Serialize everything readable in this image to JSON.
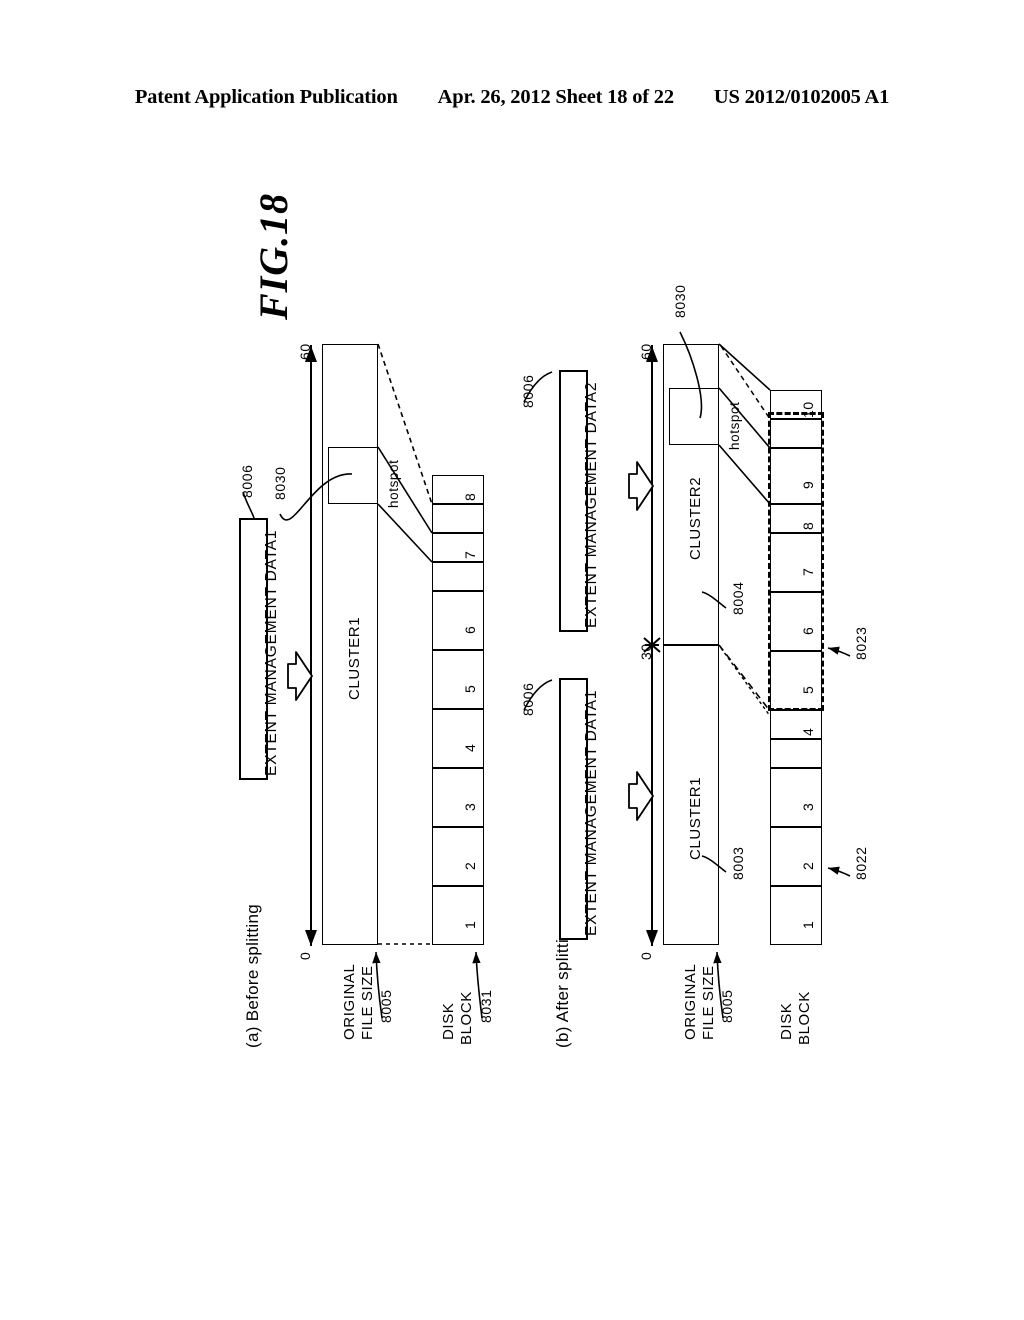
{
  "header": {
    "left": "Patent Application Publication",
    "middle": "Apr. 26, 2012  Sheet 18 of 22",
    "right": "US 2012/0102005 A1"
  },
  "figure": {
    "title": "FIG.18",
    "panels": [
      {
        "id": "a",
        "caption": "(a) Before splitting",
        "extent_box_label": "EXTENT MANAGEMENT DATA1",
        "extent_box_ref": "8006",
        "hotspot_ref": "8030",
        "hotspot_label": "hotspot",
        "clusters": [
          {
            "name": "CLUSTER1",
            "start": 0,
            "end": 60
          }
        ],
        "axis": {
          "ticks": [
            "0",
            "60"
          ],
          "min": 0,
          "max": 60
        },
        "axis_label": "ORIGINAL\nFILE SIZE",
        "axis_label_line1": "ORIGINAL",
        "axis_label_line2": "FILE SIZE",
        "axis_label_ref": "8005",
        "blocks_label_line1": "DISK",
        "blocks_label_line2": "BLOCK",
        "blocks_ref": "8031",
        "blocks": [
          "1",
          "2",
          "3",
          "4",
          "5",
          "6",
          "7",
          "8"
        ]
      },
      {
        "id": "b",
        "caption": "(b) After splitting",
        "extent_box1_label": "EXTENT MANAGEMENT DATA1",
        "extent_box1_ref": "8006",
        "extent_box2_label": "EXTENT MANAGEMENT DATA2",
        "extent_box2_ref": "8006",
        "hotspot_ref": "8030",
        "hotspot_label": "hotspot",
        "clusters": [
          {
            "name": "CLUSTER1",
            "ref": "8003",
            "start": 0,
            "end": 30
          },
          {
            "name": "CLUSTER2",
            "ref": "8004",
            "start": 30,
            "end": 60
          }
        ],
        "axis": {
          "ticks": [
            "0",
            "30",
            "60"
          ],
          "min": 0,
          "max": 60
        },
        "axis_label_line1": "ORIGINAL",
        "axis_label_line2": "FILE SIZE",
        "axis_label_ref": "8005",
        "blocks_label_line1": "DISK",
        "blocks_label_line2": "BLOCK",
        "blocks": [
          "1",
          "2",
          "3",
          "4",
          "5",
          "6",
          "7",
          "8",
          "9",
          "10"
        ],
        "block_group_refs": [
          "8022",
          "8023"
        ]
      }
    ]
  }
}
